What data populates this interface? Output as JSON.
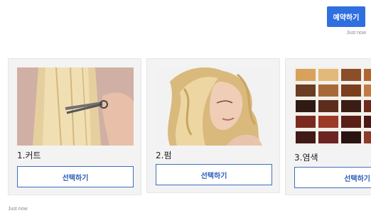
{
  "header": {
    "reserve_label": "예약하기",
    "timestamp": "Just now"
  },
  "cards": [
    {
      "title": "1.커트",
      "button_label": "선택하기",
      "image": "haircut-photo"
    },
    {
      "title": "2.펌",
      "button_label": "선택하기",
      "image": "wavy-hair-photo"
    },
    {
      "title": "3.염색",
      "button_label": "선택하기",
      "image": "hair-color-swatches"
    }
  ],
  "footer": {
    "timestamp": "Just now"
  },
  "colors": {
    "primary_button": "#2f6fe0",
    "select_button_border": "#3d6fbf",
    "card_background": "#f3f3f3"
  }
}
